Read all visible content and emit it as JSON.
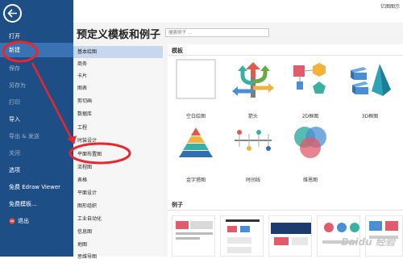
{
  "app": {
    "name": "亿图图示"
  },
  "sidebar": {
    "items": [
      {
        "label": "打开",
        "dim": false
      },
      {
        "label": "新建",
        "dim": false,
        "active": true
      },
      {
        "label": "保存",
        "dim": true
      },
      {
        "label": "另存为",
        "dim": true
      },
      {
        "label": "打印",
        "dim": true
      },
      {
        "label": "导入",
        "dim": false
      },
      {
        "label": "导出 & 发送",
        "dim": true
      },
      {
        "label": "关闭",
        "dim": true
      },
      {
        "label": "选项",
        "dim": false
      },
      {
        "label": "免费 Edraw Viewer",
        "dim": false
      },
      {
        "label": "免费模板...",
        "dim": false
      },
      {
        "label": "退出",
        "dim": false
      }
    ]
  },
  "page": {
    "title": "预定义模板和例子",
    "search_placeholder": "搜索例子 ..."
  },
  "categories": [
    "基本绘图",
    "商务",
    "卡片",
    "图表",
    "剪切画",
    "数据库",
    "工程",
    "时装设计",
    "平面布置图",
    "流程图",
    "表格",
    "平面设计",
    "图形组织",
    "工业自动化",
    "信息图",
    "地图",
    "思维导图"
  ],
  "selected_category": "基本绘图",
  "templates": {
    "header": "模板",
    "tiles": [
      {
        "label": "空白绘图"
      },
      {
        "label": "箭头"
      },
      {
        "label": "2D框图"
      },
      {
        "label": "3D框图"
      },
      {
        "label": "金字塔图"
      },
      {
        "label": "时间线"
      },
      {
        "label": "维恩图"
      }
    ]
  },
  "examples": {
    "header": "例子"
  },
  "watermark": "Baidu 经验",
  "colors": {
    "sidebar": "#1d4f86",
    "sidebar_active": "#3a73b4",
    "selected_category": "#c6d7ee",
    "annotation_red": "#e8262d"
  }
}
